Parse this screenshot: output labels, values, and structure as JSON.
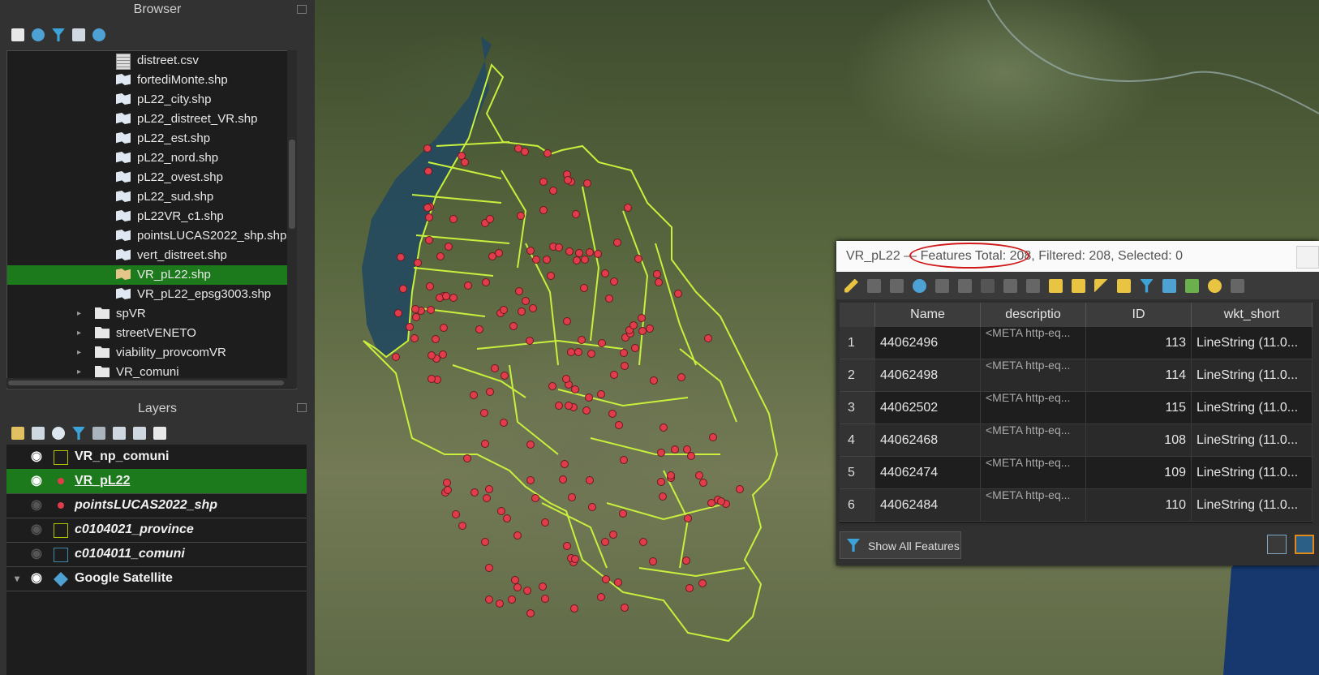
{
  "browser": {
    "title": "Browser",
    "items": [
      {
        "label": "distreet.csv",
        "icon": "csv-file-icon",
        "selected": false
      },
      {
        "label": "fortediMonte.shp",
        "icon": "shapefile-icon",
        "selected": false
      },
      {
        "label": "pL22_city.shp",
        "icon": "shapefile-icon",
        "selected": false
      },
      {
        "label": "pL22_distreet_VR.shp",
        "icon": "shapefile-icon",
        "selected": false
      },
      {
        "label": "pL22_est.shp",
        "icon": "shapefile-icon",
        "selected": false
      },
      {
        "label": "pL22_nord.shp",
        "icon": "shapefile-icon",
        "selected": false
      },
      {
        "label": "pL22_ovest.shp",
        "icon": "shapefile-icon",
        "selected": false
      },
      {
        "label": "pL22_sud.shp",
        "icon": "shapefile-icon",
        "selected": false
      },
      {
        "label": "pL22VR_c1.shp",
        "icon": "shapefile-icon",
        "selected": false
      },
      {
        "label": "pointsLUCAS2022_shp.shp",
        "icon": "shapefile-icon",
        "selected": false
      },
      {
        "label": "vert_distreet.shp",
        "icon": "shapefile-icon",
        "selected": false
      },
      {
        "label": "VR_pL22.shp",
        "icon": "shapefile-icon",
        "selected": true
      },
      {
        "label": "VR_pL22_epsg3003.shp",
        "icon": "shapefile-icon",
        "selected": false
      },
      {
        "label": "spVR",
        "icon": "folder-icon",
        "selected": false
      },
      {
        "label": "streetVENETO",
        "icon": "folder-icon",
        "selected": false
      },
      {
        "label": "viability_provcomVR",
        "icon": "folder-icon",
        "selected": false
      },
      {
        "label": "VR_comuni",
        "icon": "folder-icon",
        "selected": false
      }
    ]
  },
  "layers": {
    "title": "Layers",
    "items": [
      {
        "label": "VR_np_comuni",
        "visible": true,
        "symbol": "square-outline",
        "symbol_color": "#b5c400",
        "italic": false,
        "selected": false
      },
      {
        "label": "VR_pL22",
        "visible": true,
        "symbol": "point",
        "symbol_color": "#e03c4a",
        "italic": false,
        "selected": true
      },
      {
        "label": "pointsLUCAS2022_shp",
        "visible": false,
        "symbol": "point",
        "symbol_color": "#e03c4a",
        "italic": true,
        "selected": false
      },
      {
        "label": "c0104021_province",
        "visible": false,
        "symbol": "square-outline",
        "symbol_color": "#b5c400",
        "italic": true,
        "selected": false
      },
      {
        "label": "c0104011_comuni",
        "visible": false,
        "symbol": "square-outline",
        "symbol_color": "#3d8aa8",
        "italic": true,
        "selected": false
      },
      {
        "label": "Google Satellite",
        "visible": true,
        "symbol": "xyz-tile",
        "symbol_color": "#4ea1d3",
        "italic": false,
        "selected": false
      }
    ]
  },
  "attribute_table": {
    "title_prefix": "VR_pL22 — ",
    "title_features": "Features Total: 208",
    "title_suffix": ", Filtered: 208, Selected: 0",
    "columns": [
      "Name",
      "descriptio",
      "ID",
      "wkt_short"
    ],
    "rows": [
      {
        "num": "1",
        "name": "44062496",
        "desc": "<META http-eq...",
        "id": "113",
        "wkt": "LineString (11.0..."
      },
      {
        "num": "2",
        "name": "44062498",
        "desc": "<META http-eq...",
        "id": "114",
        "wkt": "LineString (11.0..."
      },
      {
        "num": "3",
        "name": "44062502",
        "desc": "<META http-eq...",
        "id": "115",
        "wkt": "LineString (11.0..."
      },
      {
        "num": "4",
        "name": "44062468",
        "desc": "<META http-eq...",
        "id": "108",
        "wkt": "LineString (11.0..."
      },
      {
        "num": "5",
        "name": "44062474",
        "desc": "<META http-eq...",
        "id": "109",
        "wkt": "LineString (11.0..."
      },
      {
        "num": "6",
        "name": "44062484",
        "desc": "<META http-eq...",
        "id": "110",
        "wkt": "LineString (11.0..."
      }
    ],
    "footer_button": "Show All Features"
  },
  "colors": {
    "selection": "#1c7a1c",
    "boundary": "#c8f03c",
    "point": "#e03c4a",
    "highlight_ellipse": "#d01818"
  }
}
